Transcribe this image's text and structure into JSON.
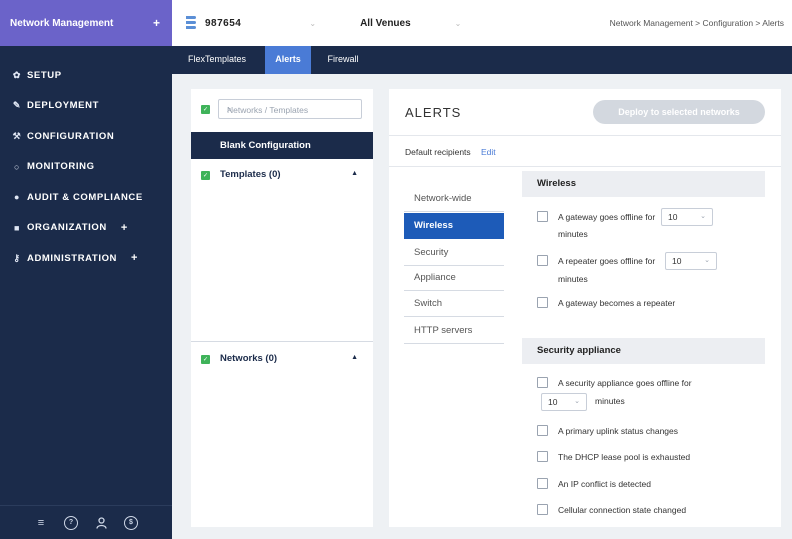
{
  "sidebar": {
    "header": "Network Management",
    "header_plus": "+",
    "items": [
      {
        "label": "SETUP",
        "icon": "gear-icon"
      },
      {
        "label": "DEPLOYMENT",
        "icon": "pencil-icon"
      },
      {
        "label": "CONFIGURATION",
        "icon": "wrench-icon"
      },
      {
        "label": "MONITORING",
        "icon": "circle-icon"
      },
      {
        "label": "AUDIT & COMPLIANCE",
        "icon": "shield-icon"
      },
      {
        "label": "ORGANIZATION",
        "icon": "building-icon",
        "plus": "+"
      },
      {
        "label": "ADMINISTRATION",
        "icon": "key-icon",
        "plus": "+"
      }
    ]
  },
  "topbar": {
    "network_id": "987654",
    "venue": "All Venues",
    "breadcrumb": "Network Management > Configuration > Alerts"
  },
  "tabs": [
    {
      "label": "FlexTemplates",
      "active": false
    },
    {
      "label": "Alerts",
      "active": true
    },
    {
      "label": "Firewall",
      "active": false
    }
  ],
  "left_panel": {
    "search_placeholder": "Networks / Templates",
    "blank_config": "Blank Configuration",
    "templates_label": "Templates (0)",
    "networks_label": "Networks (0)"
  },
  "alerts": {
    "title": "ALERTS",
    "deploy_button": "Deploy to selected networks",
    "default_recipients": "Default recipients",
    "edit_link": "Edit",
    "nav": [
      "Network-wide",
      "Wireless",
      "Security",
      "Appliance",
      "Switch",
      "HTTP servers"
    ],
    "selected_nav": "Wireless",
    "wireless": {
      "heading": "Wireless",
      "gateway_offline": "A gateway goes offline for",
      "gateway_offline_value": "10",
      "gateway_offline_unit": "minutes",
      "repeater_offline": "A repeater goes offline for",
      "repeater_offline_value": "10",
      "repeater_offline_unit": "minutes",
      "gateway_repeater": "A gateway becomes a repeater"
    },
    "security": {
      "heading": "Security appliance",
      "appliance_offline": "A security appliance goes offline for",
      "appliance_offline_value": "10",
      "appliance_offline_unit": "minutes",
      "uplink": "A primary uplink status changes",
      "dhcp": "The DHCP lease pool is exhausted",
      "ip_conflict": "An IP conflict is detected",
      "cellular": "Cellular connection state changed"
    }
  }
}
